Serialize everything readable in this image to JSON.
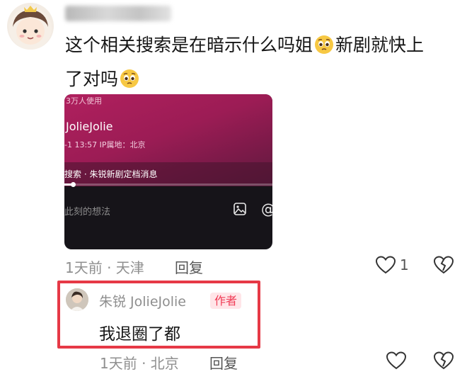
{
  "comment": {
    "text_line1": "这个相关搜索是在暗示什么吗姐",
    "text_line1_tail": "新剧就快上",
    "text_line2": "了对吗",
    "time_location": "1天前 · 天津",
    "reply_label": "回复",
    "like_count": "1"
  },
  "embedded_screenshot": {
    "usage_text": "3万人使用",
    "account_name": "JolieJolie",
    "meta_text": "-1 13:57  IP属地：北京",
    "related_search": "搜索 · 朱锐新剧定档消息",
    "input_placeholder": "此刻的想法",
    "at_symbol": "@",
    "progress": 0.04
  },
  "reply": {
    "name": "朱锐 JolieJolie",
    "badge": "作者",
    "text": "我退圈了都",
    "time_location": "1天前 · 北京",
    "reply_label": "回复"
  },
  "colors": {
    "highlight_border": "#e63946",
    "badge_text": "#f03b55",
    "badge_bg": "#ffe5e8"
  },
  "icons": [
    "heart-icon",
    "dislike-icon",
    "image-icon",
    "pleading-emoji-icon"
  ]
}
